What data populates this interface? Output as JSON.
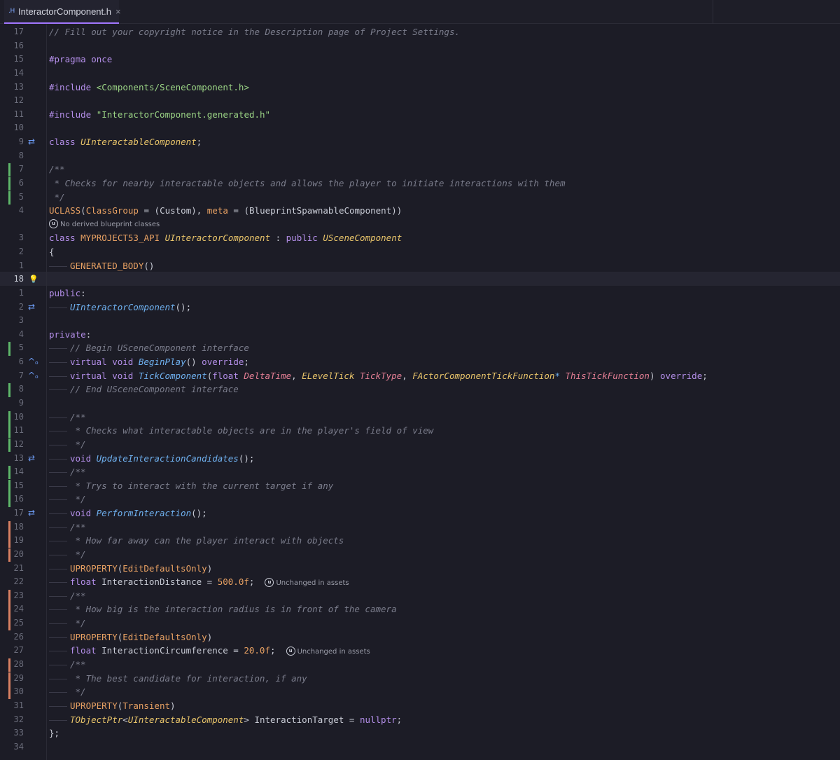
{
  "tab": {
    "icon": ".H",
    "filename": "InteractorComponent.h",
    "close": "×"
  },
  "hints": {
    "no_derived": "No derived blueprint classes",
    "unchanged": "Unchanged in assets",
    "ue_glyph": "u"
  },
  "lines": [
    {
      "n": "17",
      "code": [
        [
          "c-comment",
          "// Fill out your copyright notice in the Description page of Project Settings."
        ]
      ]
    },
    {
      "n": "16",
      "code": []
    },
    {
      "n": "15",
      "code": [
        [
          "c-pp",
          "#pragma once"
        ]
      ]
    },
    {
      "n": "14",
      "code": []
    },
    {
      "n": "13",
      "code": [
        [
          "c-pp",
          "#include "
        ],
        [
          "c-str",
          "<Components/SceneComponent.h>"
        ]
      ]
    },
    {
      "n": "12",
      "code": []
    },
    {
      "n": "11",
      "code": [
        [
          "c-pp",
          "#include "
        ],
        [
          "c-str",
          "\"InteractorComponent.generated.h\""
        ]
      ]
    },
    {
      "n": "10",
      "code": []
    },
    {
      "n": "9",
      "icon": "⇄",
      "code": [
        [
          "c-kw",
          "class "
        ],
        [
          "c-type",
          "UInteractableComponent"
        ],
        [
          "c-plain",
          ";"
        ]
      ]
    },
    {
      "n": "8",
      "code": []
    },
    {
      "n": "7",
      "vcs": "green",
      "code": [
        [
          "c-comment",
          "/**"
        ]
      ]
    },
    {
      "n": "6",
      "vcs": "green",
      "code": [
        [
          "c-comment",
          " * Checks for nearby interactable objects and allows the player to initiate interactions with them"
        ]
      ]
    },
    {
      "n": "5",
      "vcs": "green",
      "code": [
        [
          "c-comment",
          " */"
        ]
      ]
    },
    {
      "n": "4",
      "code": [
        [
          "c-macro",
          "UCLASS"
        ],
        [
          "c-plain",
          "("
        ],
        [
          "c-macro",
          "ClassGroup"
        ],
        [
          "c-plain",
          " = ("
        ],
        [
          "c-plain",
          "Custom"
        ],
        [
          "c-plain",
          "), "
        ],
        [
          "c-macro",
          "meta"
        ],
        [
          "c-plain",
          " = ("
        ],
        [
          "c-plain",
          "BlueprintSpawnableComponent"
        ],
        [
          "c-plain",
          "))"
        ]
      ]
    },
    {
      "hint": "no_derived",
      "code": []
    },
    {
      "n": "3",
      "code": [
        [
          "c-kw",
          "class "
        ],
        [
          "c-api",
          "MYPROJECT53_API "
        ],
        [
          "c-type",
          "UInteractorComponent"
        ],
        [
          "c-plain",
          " : "
        ],
        [
          "c-kw",
          "public "
        ],
        [
          "c-type",
          "USceneComponent"
        ]
      ]
    },
    {
      "n": "2",
      "code": [
        [
          "c-plain",
          "{"
        ]
      ]
    },
    {
      "n": "1",
      "indent": 1,
      "code": [
        [
          "c-macro",
          "GENERATED_BODY"
        ],
        [
          "c-plain",
          "()"
        ]
      ]
    },
    {
      "n": "18",
      "current": true,
      "icon": "bulb",
      "code": []
    },
    {
      "n": "1",
      "code": [
        [
          "c-kw",
          "public"
        ],
        [
          "c-plain",
          ":"
        ]
      ]
    },
    {
      "n": "2",
      "icon": "⇄",
      "indent": 1,
      "code": [
        [
          "c-fn",
          "UInteractorComponent"
        ],
        [
          "c-plain",
          "();"
        ]
      ]
    },
    {
      "n": "3",
      "code": []
    },
    {
      "n": "4",
      "code": [
        [
          "c-kw",
          "private"
        ],
        [
          "c-plain",
          ":"
        ]
      ]
    },
    {
      "n": "5",
      "vcs": "green",
      "indent": 1,
      "code": [
        [
          "c-comment",
          "// Begin USceneComponent interface"
        ]
      ]
    },
    {
      "n": "6",
      "icon": "override",
      "indent": 1,
      "code": [
        [
          "c-kw",
          "virtual "
        ],
        [
          "c-kw",
          "void "
        ],
        [
          "c-fn",
          "BeginPlay"
        ],
        [
          "c-plain",
          "() "
        ],
        [
          "c-kw",
          "override"
        ],
        [
          "c-plain",
          ";"
        ]
      ]
    },
    {
      "n": "7",
      "icon": "override",
      "indent": 1,
      "code": [
        [
          "c-kw",
          "virtual "
        ],
        [
          "c-kw",
          "void "
        ],
        [
          "c-fn",
          "TickComponent"
        ],
        [
          "c-plain",
          "("
        ],
        [
          "c-kw",
          "float "
        ],
        [
          "c-param",
          "DeltaTime"
        ],
        [
          "c-plain",
          ", "
        ],
        [
          "c-type",
          "ELevelTick "
        ],
        [
          "c-param",
          "TickType"
        ],
        [
          "c-plain",
          ", "
        ],
        [
          "c-type",
          "FActorComponentTickFunction"
        ],
        [
          "c-ptr",
          "* "
        ],
        [
          "c-param",
          "ThisTickFunction"
        ],
        [
          "c-plain",
          ") "
        ],
        [
          "c-kw",
          "override"
        ],
        [
          "c-plain",
          ";"
        ]
      ]
    },
    {
      "n": "8",
      "vcs": "green",
      "indent": 1,
      "code": [
        [
          "c-comment",
          "// End USceneComponent interface"
        ]
      ]
    },
    {
      "n": "9",
      "code": []
    },
    {
      "n": "10",
      "vcs": "green",
      "indent": 1,
      "code": [
        [
          "c-comment",
          "/**"
        ]
      ]
    },
    {
      "n": "11",
      "vcs": "green",
      "indent": 1,
      "code": [
        [
          "c-comment",
          " * Checks what interactable objects are in the player's field of view"
        ]
      ]
    },
    {
      "n": "12",
      "vcs": "green",
      "indent": 1,
      "code": [
        [
          "c-comment",
          " */"
        ]
      ]
    },
    {
      "n": "13",
      "icon": "⇄",
      "indent": 1,
      "code": [
        [
          "c-kw",
          "void "
        ],
        [
          "c-fn",
          "UpdateInteractionCandidates"
        ],
        [
          "c-plain",
          "();"
        ]
      ]
    },
    {
      "n": "14",
      "vcs": "green",
      "indent": 1,
      "code": [
        [
          "c-comment",
          "/**"
        ]
      ]
    },
    {
      "n": "15",
      "vcs": "green",
      "indent": 1,
      "code": [
        [
          "c-comment",
          " * Trys to interact with the current target if any"
        ]
      ]
    },
    {
      "n": "16",
      "vcs": "green",
      "indent": 1,
      "code": [
        [
          "c-comment",
          " */"
        ]
      ]
    },
    {
      "n": "17",
      "icon": "⇄",
      "indent": 1,
      "code": [
        [
          "c-kw",
          "void "
        ],
        [
          "c-fn",
          "PerformInteraction"
        ],
        [
          "c-plain",
          "();"
        ]
      ]
    },
    {
      "n": "18",
      "vcs": "orange",
      "indent": 1,
      "code": [
        [
          "c-comment",
          "/**"
        ]
      ]
    },
    {
      "n": "19",
      "vcs": "orange",
      "indent": 1,
      "code": [
        [
          "c-comment",
          " * How far away can the player interact with objects"
        ]
      ]
    },
    {
      "n": "20",
      "vcs": "orange",
      "indent": 1,
      "code": [
        [
          "c-comment",
          " */"
        ]
      ]
    },
    {
      "n": "21",
      "indent": 1,
      "code": [
        [
          "c-macro",
          "UPROPERTY"
        ],
        [
          "c-plain",
          "("
        ],
        [
          "c-macro",
          "EditDefaultsOnly"
        ],
        [
          "c-plain",
          ")"
        ]
      ]
    },
    {
      "n": "22",
      "indent": 1,
      "trail": "unchanged",
      "code": [
        [
          "c-kw",
          "float "
        ],
        [
          "c-field",
          "InteractionDistance"
        ],
        [
          "c-plain",
          " = "
        ],
        [
          "c-num",
          "500.0f"
        ],
        [
          "c-plain",
          ";"
        ]
      ]
    },
    {
      "n": "23",
      "vcs": "orange",
      "indent": 1,
      "code": [
        [
          "c-comment",
          "/**"
        ]
      ]
    },
    {
      "n": "24",
      "vcs": "orange",
      "indent": 1,
      "code": [
        [
          "c-comment",
          " * How big is the interaction radius is in front of the camera"
        ]
      ]
    },
    {
      "n": "25",
      "vcs": "orange",
      "indent": 1,
      "code": [
        [
          "c-comment",
          " */"
        ]
      ]
    },
    {
      "n": "26",
      "indent": 1,
      "code": [
        [
          "c-macro",
          "UPROPERTY"
        ],
        [
          "c-plain",
          "("
        ],
        [
          "c-macro",
          "EditDefaultsOnly"
        ],
        [
          "c-plain",
          ")"
        ]
      ]
    },
    {
      "n": "27",
      "indent": 1,
      "trail": "unchanged",
      "code": [
        [
          "c-kw",
          "float "
        ],
        [
          "c-field",
          "InteractionCircumference"
        ],
        [
          "c-plain",
          " = "
        ],
        [
          "c-num",
          "20.0f"
        ],
        [
          "c-plain",
          ";"
        ]
      ]
    },
    {
      "n": "28",
      "vcs": "orange",
      "indent": 1,
      "code": [
        [
          "c-comment",
          "/**"
        ]
      ]
    },
    {
      "n": "29",
      "vcs": "orange",
      "indent": 1,
      "code": [
        [
          "c-comment",
          " * The best candidate for interaction, if any"
        ]
      ]
    },
    {
      "n": "30",
      "vcs": "orange",
      "indent": 1,
      "code": [
        [
          "c-comment",
          " */"
        ]
      ]
    },
    {
      "n": "31",
      "indent": 1,
      "code": [
        [
          "c-macro",
          "UPROPERTY"
        ],
        [
          "c-plain",
          "("
        ],
        [
          "c-macro",
          "Transient"
        ],
        [
          "c-plain",
          ")"
        ]
      ]
    },
    {
      "n": "32",
      "indent": 1,
      "code": [
        [
          "c-type",
          "TObjectPtr"
        ],
        [
          "c-plain",
          "<"
        ],
        [
          "c-type",
          "UInteractableComponent"
        ],
        [
          "c-plain",
          "> "
        ],
        [
          "c-field",
          "InteractionTarget"
        ],
        [
          "c-plain",
          " = "
        ],
        [
          "c-kw",
          "nullptr"
        ],
        [
          "c-plain",
          ";"
        ]
      ]
    },
    {
      "n": "33",
      "code": [
        [
          "c-plain",
          "};"
        ]
      ]
    },
    {
      "n": "34",
      "code": []
    }
  ]
}
